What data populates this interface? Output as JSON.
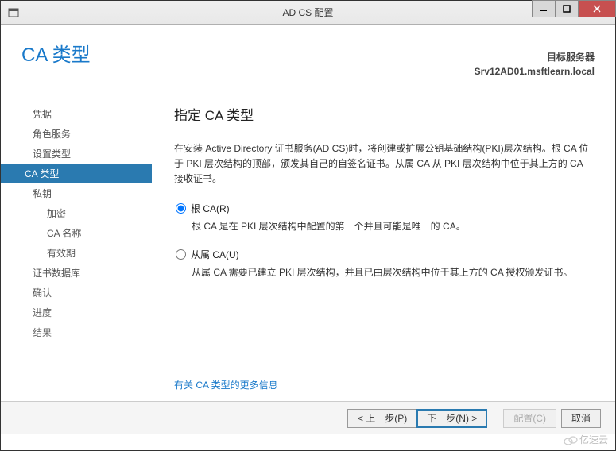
{
  "window": {
    "title": "AD CS 配置"
  },
  "header": {
    "page_title": "CA 类型",
    "target_label": "目标服务器",
    "target_server": "Srv12AD01.msftlearn.local"
  },
  "sidebar": {
    "items": [
      {
        "label": "凭据",
        "sub": false,
        "enabled": true
      },
      {
        "label": "角色服务",
        "sub": false,
        "enabled": true
      },
      {
        "label": "设置类型",
        "sub": false,
        "enabled": true
      },
      {
        "label": "CA 类型",
        "sub": false,
        "selected": true
      },
      {
        "label": "私钥",
        "sub": false,
        "enabled": true
      },
      {
        "label": "加密",
        "sub": true,
        "enabled": true
      },
      {
        "label": "CA 名称",
        "sub": true,
        "enabled": true
      },
      {
        "label": "有效期",
        "sub": true,
        "enabled": true
      },
      {
        "label": "证书数据库",
        "sub": false,
        "enabled": true
      },
      {
        "label": "确认",
        "sub": false,
        "enabled": true
      },
      {
        "label": "进度",
        "sub": false,
        "enabled": false
      },
      {
        "label": "结果",
        "sub": false,
        "enabled": false
      }
    ]
  },
  "content": {
    "heading": "指定 CA 类型",
    "description": "在安装 Active Directory 证书服务(AD CS)时，将创建或扩展公钥基础结构(PKI)层次结构。根 CA 位于 PKI 层次结构的顶部，颁发其自己的自签名证书。从属 CA 从 PKI 层次结构中位于其上方的 CA 接收证书。",
    "options": [
      {
        "label": "根 CA(R)",
        "desc": "根 CA 是在 PKI 层次结构中配置的第一个并且可能是唯一的 CA。",
        "checked": true
      },
      {
        "label": "从属 CA(U)",
        "desc": "从属 CA 需要已建立 PKI 层次结构，并且已由层次结构中位于其上方的 CA 授权颁发证书。",
        "checked": false
      }
    ],
    "more_link": "有关 CA 类型的更多信息"
  },
  "footer": {
    "prev": "< 上一步(P)",
    "next": "下一步(N) >",
    "configure": "配置(C)",
    "cancel": "取消"
  },
  "watermark": "亿速云"
}
